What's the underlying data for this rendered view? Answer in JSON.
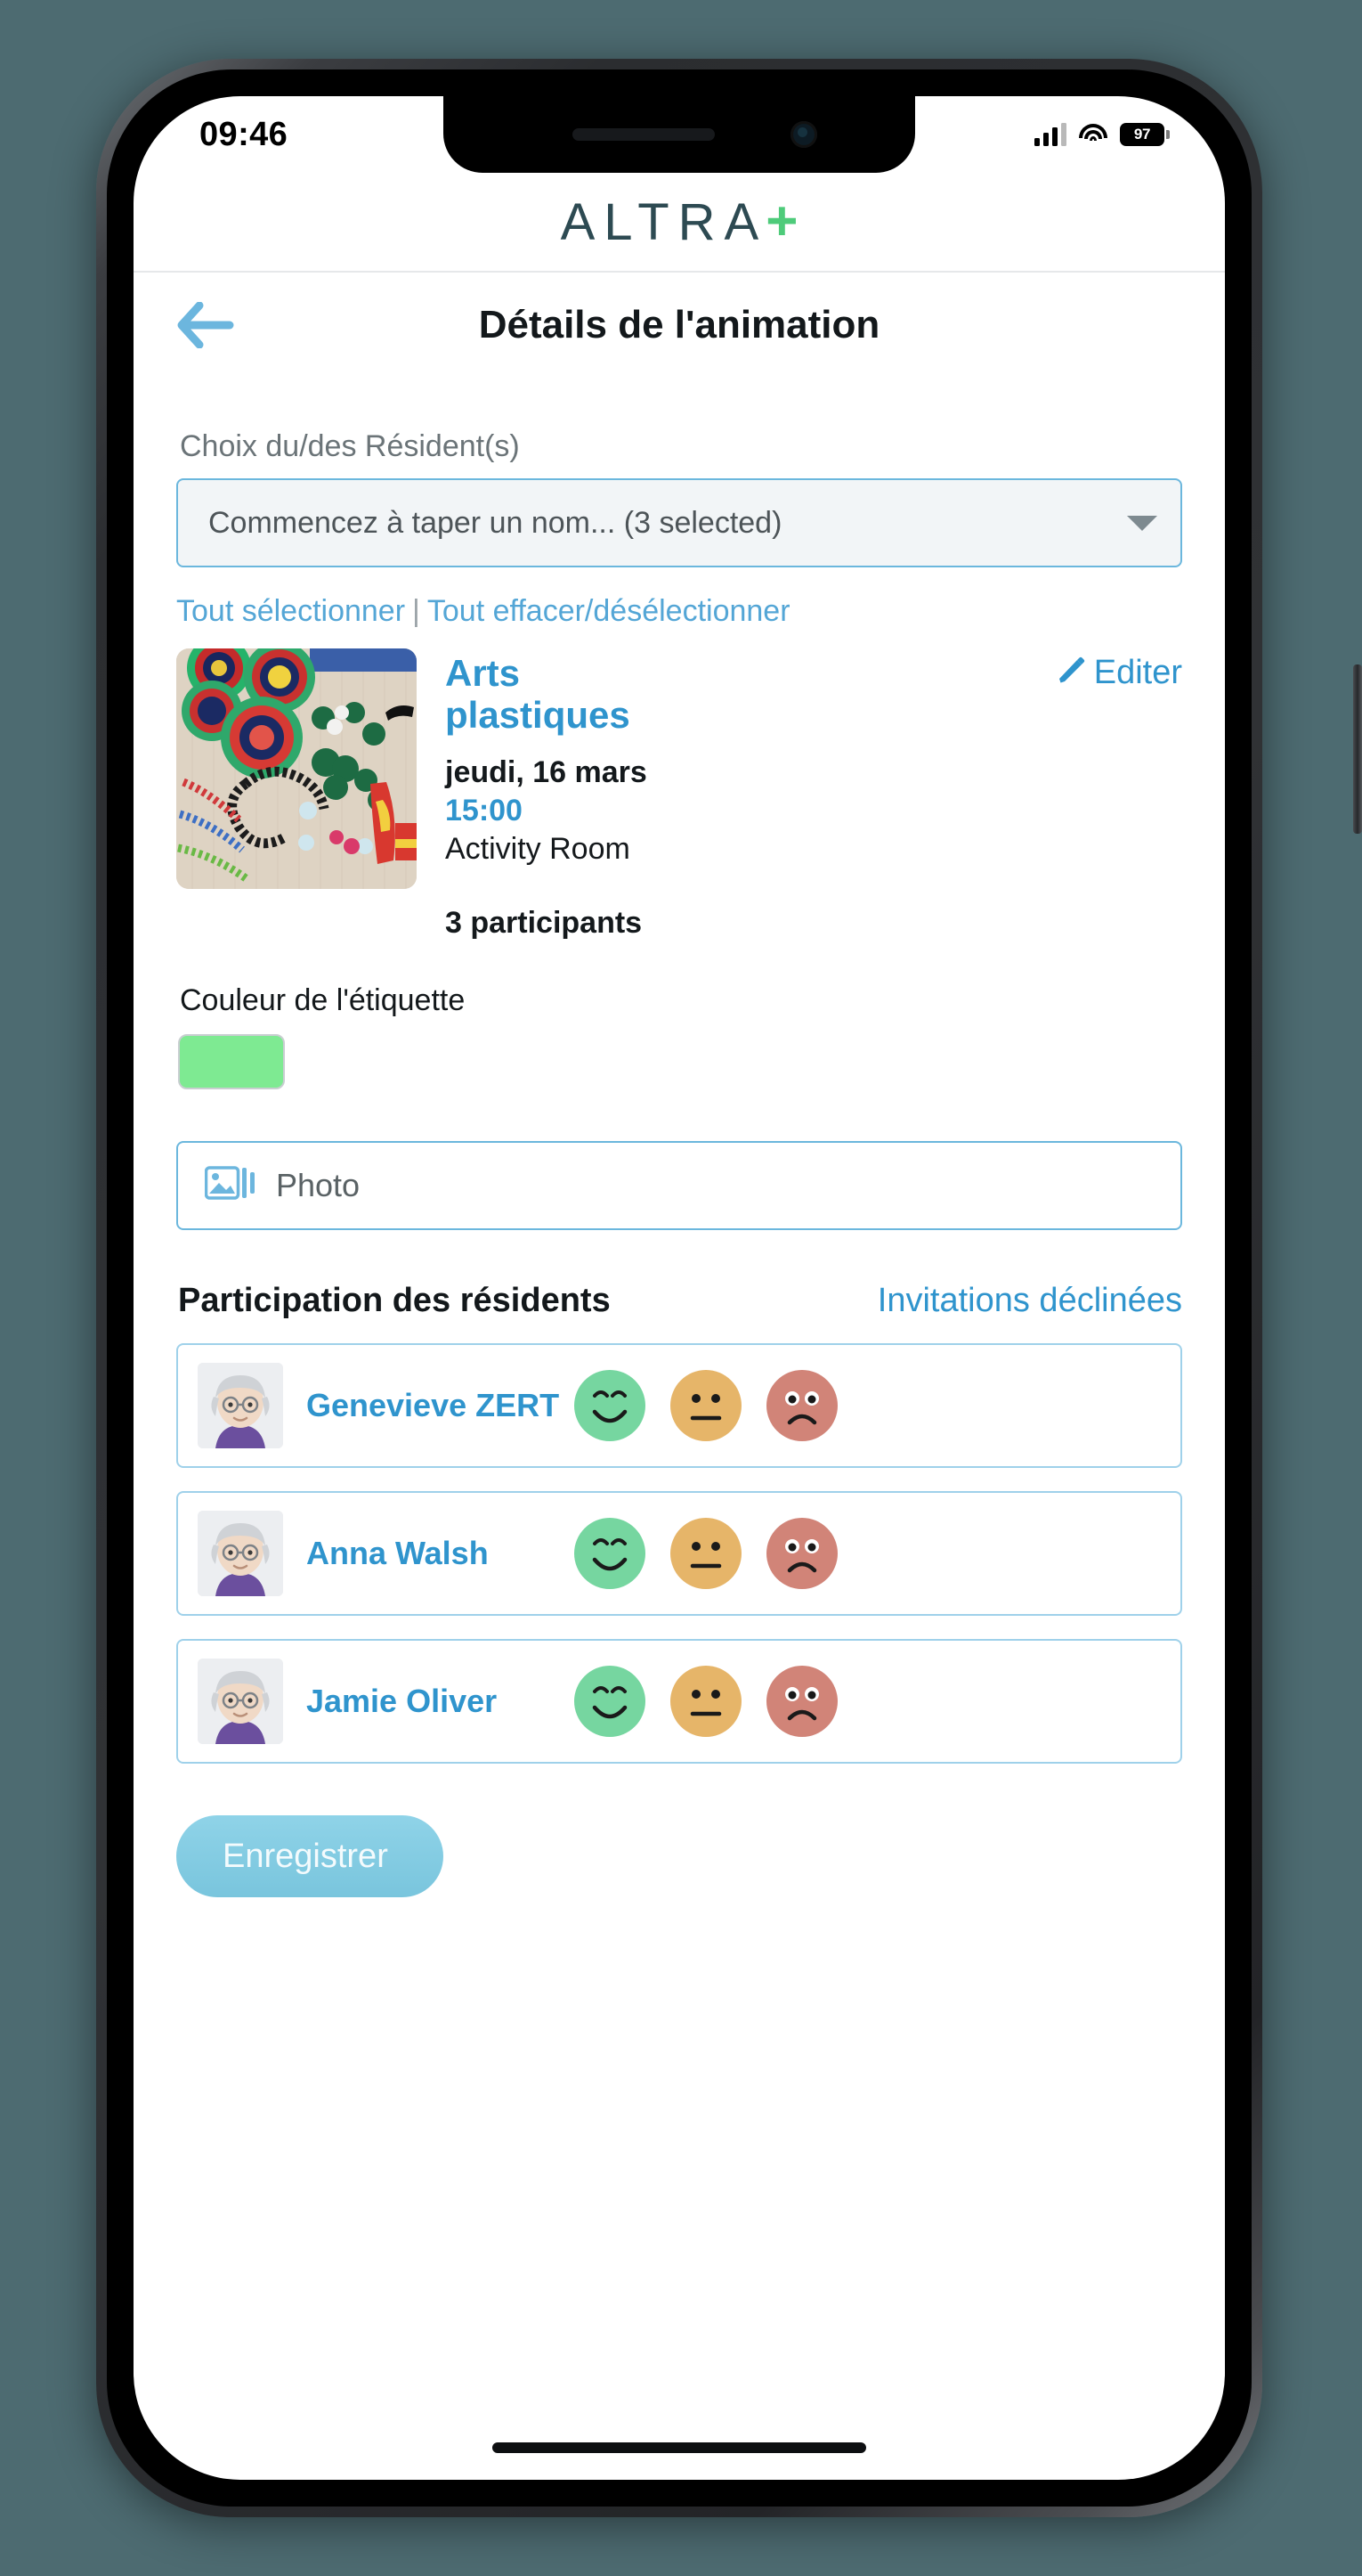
{
  "status_bar": {
    "time": "09:46",
    "battery_percent": "97",
    "signal_icon": "cellular-signal-icon",
    "wifi_icon": "wifi-icon",
    "battery_icon": "battery-icon"
  },
  "brand": {
    "word": "ALTRA",
    "plus": "+",
    "word_color": "#2d4a52",
    "plus_color": "#4ecb7a"
  },
  "header": {
    "back_icon": "back-arrow-icon",
    "title": "Détails de l'animation"
  },
  "resident_select": {
    "label": "Choix du/des Résident(s)",
    "value": "Commencez à taper un nom... (3 selected)",
    "caret_icon": "chevron-down-icon",
    "select_all": "Tout sélectionner",
    "separator": "|",
    "clear_all": "Tout effacer/désélectionner"
  },
  "activity": {
    "thumbnail_alt": "arts-and-crafts-photo",
    "title": "Arts plastiques",
    "edit_icon": "pencil-icon",
    "edit_label": "Editer",
    "date": "jeudi, 16 mars",
    "time": "15:00",
    "place": "Activity Room",
    "participants": "3 participants"
  },
  "color_label": {
    "title": "Couleur de l'étiquette",
    "swatch_color": "#7eea92"
  },
  "photo_field": {
    "icon": "photo-library-icon",
    "placeholder": "Photo"
  },
  "participation": {
    "title": "Participation des résidents",
    "declined_link": "Invitations déclinées",
    "faces": [
      {
        "name": "happy-face-icon",
        "color": "#76d6a0"
      },
      {
        "name": "neutral-face-icon",
        "color": "#e6b569"
      },
      {
        "name": "sad-face-icon",
        "color": "#d18478"
      }
    ],
    "residents": [
      {
        "name": "Genevieve ZERT",
        "avatar": "resident-avatar"
      },
      {
        "name": "Anna Walsh",
        "avatar": "resident-avatar"
      },
      {
        "name": "Jamie Oliver",
        "avatar": "resident-avatar"
      }
    ]
  },
  "save": {
    "label": "Enregistrer"
  }
}
